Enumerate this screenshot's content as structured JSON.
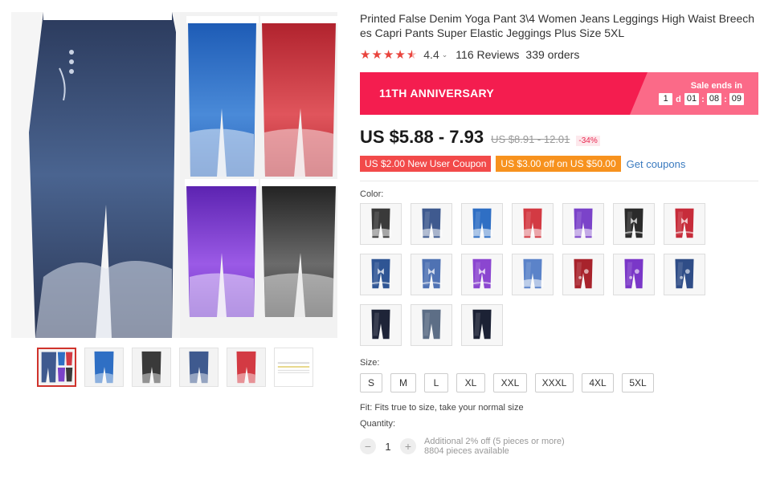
{
  "product": {
    "title": "Printed False Denim Yoga Pant 3\\4 Women Jeans Leggings High Waist Breeches Capri Pants Super Elastic Jeggings Plus Size 5XL",
    "rating": "4.4",
    "rating_stars": 4.4,
    "reviews": "116 Reviews",
    "orders": "339 orders"
  },
  "banner": {
    "title": "11TH ANNIVERSARY",
    "sale_ends_label": "Sale ends in",
    "days": "1",
    "days_unit": "d",
    "hours": "01",
    "minutes": "08",
    "seconds": "09"
  },
  "price": {
    "current": "US $5.88 - 7.93",
    "original": "US $8.91 - 12.01",
    "discount": "-34%"
  },
  "coupons": {
    "new_user": "US $2.00 New User Coupon",
    "store": "US $3.00 off on US $50.00",
    "get_label": "Get coupons"
  },
  "color": {
    "label": "Color:",
    "swatch_colors": [
      "#3a3a3a",
      "#3f5a8f",
      "#2f6fc4",
      "#d33a43",
      "#7b43c9",
      "#2b2b2b",
      "#c72c3a",
      "#2f5594",
      "#4f72b3",
      "#8b46d0",
      "#5b83c9",
      "#a8232c",
      "#7a37c8",
      "#2f4d87",
      "#1e2438",
      "#5d6e86",
      "#1c2235"
    ],
    "swatch_patterns": [
      "lace",
      "lace",
      "lace",
      "lace",
      "lace",
      "butterfly",
      "butterfly",
      "butterfly",
      "butterfly",
      "butterfly",
      "lace",
      "floral",
      "floral",
      "floral",
      "plain",
      "plain",
      "plain"
    ]
  },
  "gallery": {
    "thumb_colors": [
      "#3f5a8f",
      "#2f6fc4",
      "#3a3a3a",
      "#3f5a8f",
      "#d33a43",
      "#eeeeee"
    ]
  },
  "size": {
    "label": "Size:",
    "options": [
      "S",
      "M",
      "L",
      "XL",
      "XXL",
      "XXXL",
      "4XL",
      "5XL"
    ]
  },
  "fit": "Fit: Fits true to size, take your normal size",
  "quantity": {
    "label": "Quantity:",
    "value": "1",
    "minus": "−",
    "plus": "+",
    "discount_note": "Additional 2% off (5 pieces or more)",
    "available": "8804 pieces available"
  }
}
